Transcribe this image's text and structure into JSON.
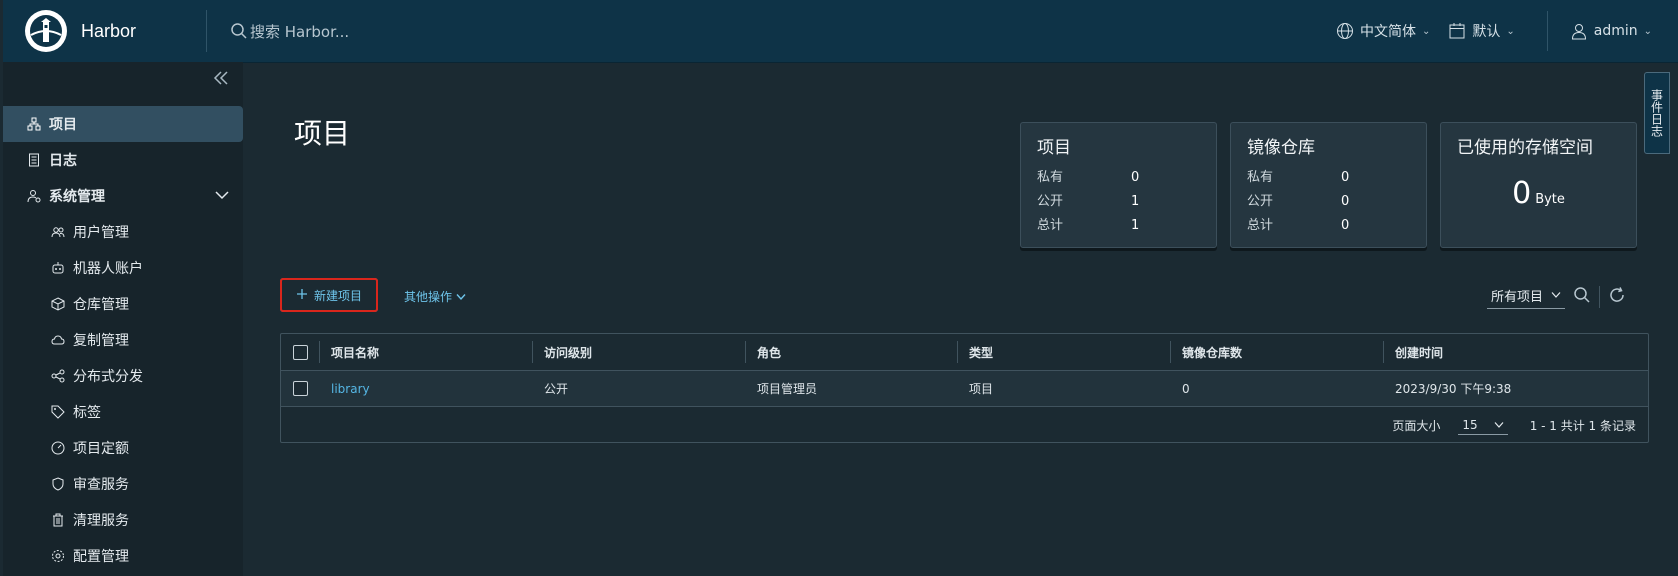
{
  "app": {
    "name": "Harbor"
  },
  "header": {
    "search_placeholder": "搜索 Harbor...",
    "language": "中文简体",
    "theme": "默认",
    "user": "admin"
  },
  "sidebar": {
    "items": [
      {
        "label": "项目",
        "icon": "project-icon",
        "active": true
      },
      {
        "label": "日志",
        "icon": "log-icon"
      },
      {
        "label": "系统管理",
        "icon": "admin-icon",
        "expanded": true
      },
      {
        "label": "用户管理",
        "icon": "users-icon"
      },
      {
        "label": "机器人账户",
        "icon": "robot-icon"
      },
      {
        "label": "仓库管理",
        "icon": "cube-icon"
      },
      {
        "label": "复制管理",
        "icon": "cloud-icon"
      },
      {
        "label": "分布式分发",
        "icon": "share-icon"
      },
      {
        "label": "标签",
        "icon": "tag-icon"
      },
      {
        "label": "项目定额",
        "icon": "gauge-icon"
      },
      {
        "label": "审查服务",
        "icon": "shield-icon"
      },
      {
        "label": "清理服务",
        "icon": "trash-icon"
      },
      {
        "label": "配置管理",
        "icon": "gear-icon"
      }
    ]
  },
  "main": {
    "title": "项目",
    "cards": [
      {
        "title": "项目",
        "rows": [
          {
            "k": "私有",
            "v": "0"
          },
          {
            "k": "公开",
            "v": "1"
          },
          {
            "k": "总计",
            "v": "1"
          }
        ]
      },
      {
        "title": "镜像仓库",
        "rows": [
          {
            "k": "私有",
            "v": "0"
          },
          {
            "k": "公开",
            "v": "0"
          },
          {
            "k": "总计",
            "v": "0"
          }
        ]
      },
      {
        "title": "已使用的存储空间",
        "value": "0",
        "unit": "Byte"
      }
    ],
    "new_project": "新建项目",
    "other_ops": "其他操作",
    "filter": "所有项目"
  },
  "table": {
    "headers": [
      "项目名称",
      "访问级别",
      "角色",
      "类型",
      "镜像仓库数",
      "创建时间"
    ],
    "rows": [
      [
        "library",
        "公开",
        "项目管理员",
        "项目",
        "0",
        "2023/9/30 下午9:38"
      ]
    ],
    "page_size_label": "页面大小",
    "page_size": "15",
    "summary": "1 - 1 共计 1 条记录"
  },
  "event_tab": "事件日志",
  "colors": {
    "header": "#0e3347",
    "accent": "#55b6e4",
    "highlight": "#d9261c"
  }
}
